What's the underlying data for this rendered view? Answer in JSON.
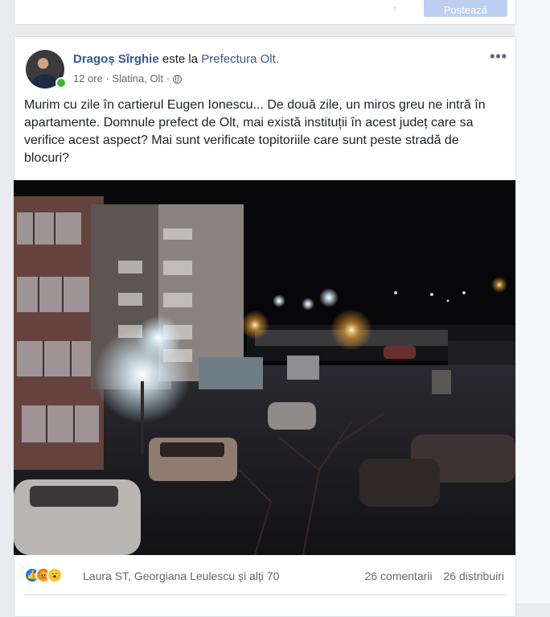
{
  "top_card": {
    "button_label": "Postează"
  },
  "post": {
    "author": "Dragoș Sîrghie",
    "connector": " este la ",
    "place": "Prefectura Olt.",
    "time": "12 ore",
    "location": "Slatina, Olt",
    "separator": "·",
    "more_label": "•••",
    "text": "Murim cu zile în cartierul Eugen Ionescu... De două zile, un miros greu ne intră în apartamente. Domnule prefect de Olt, mai există instituții în acest județ care sa verifice acest aspect? Mai sunt verificate topitoriile care sunt peste stradă de blocuri?",
    "reaction_icons": [
      "like-icon",
      "angry-icon",
      "wow-icon"
    ],
    "reaction_names": "Laura ST, Georgiana Leulescu și alți 70",
    "comments": "26 comentarii",
    "shares": "26 distribuiri"
  },
  "colors": {
    "link": "#385898",
    "like": "#2078f4",
    "online": "#42b72a"
  }
}
